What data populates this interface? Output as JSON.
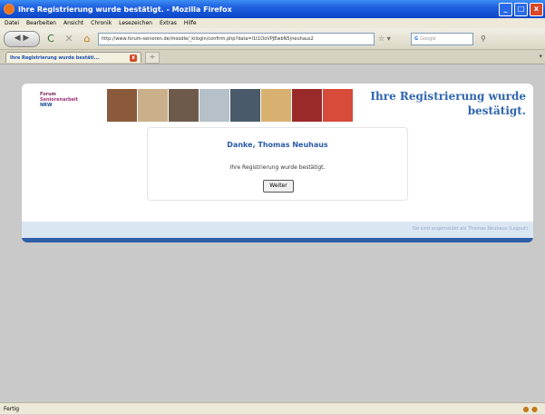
{
  "window": {
    "title": "Ihre Registrierung wurde bestätigt. - Mozilla Firefox",
    "buttons": [
      "_",
      "□",
      "x"
    ]
  },
  "menu": [
    "Datei",
    "Bearbeiten",
    "Ansicht",
    "Chronik",
    "Lesezeichen",
    "Extras",
    "Hilfe"
  ],
  "nav": {
    "back_forward": "◀ ▶",
    "reload": "C",
    "stop": "✕",
    "home": "⌂",
    "url": "http://www.forum-senioren.de/moodle/_kilogin/confirm.php?data=l1t1OoVPJEwbN5|neuhaus2",
    "url_icons": "☆ ▾",
    "search_engine": "G",
    "search_placeholder": "Google"
  },
  "tabs": [
    {
      "label": "Ihre Registrierung wurde bestäti...",
      "close": "x"
    }
  ],
  "new_tab": "+",
  "page": {
    "logo_lines": [
      "Forum",
      "Seniorenarbeit",
      "NRW"
    ],
    "banner_colors": [
      "#8b5a3c",
      "#c9b08a",
      "#6d5a4a",
      "#b5c0c8",
      "#4a5a6a",
      "#d8b070",
      "#9a2a2a",
      "#d84a3a"
    ],
    "headline": "Ihre Registrierung wurde bestätigt.",
    "thanks": "Danke, Thomas Neuhaus",
    "message": "Ihre Registrierung wurde bestätigt.",
    "weiter": "Weiter",
    "footer_text": "Sie sind angemeldet als Thomas Neuhaus (Logout)"
  },
  "status": {
    "text": "Fertig",
    "icons": "● ●"
  }
}
